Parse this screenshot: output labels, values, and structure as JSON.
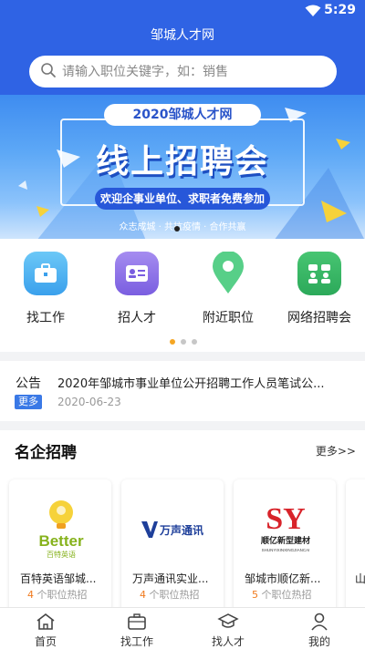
{
  "status": {
    "time": "5:29",
    "wifi_icon": "wifi-icon"
  },
  "header": {
    "title": "邹城人才网"
  },
  "search": {
    "placeholder": "请输入职位关键字，如：销售",
    "icon": "search-icon"
  },
  "banner": {
    "ribbon": "2020邹城人才网",
    "headline": "线上招聘会",
    "pill": "欢迎企事业单位、求职者免费参加",
    "tagline": "众志成城 · 共抗疫情 · 合作共赢"
  },
  "categories": [
    {
      "label": "找工作",
      "icon": "briefcase-icon",
      "color": "#4fb3f0"
    },
    {
      "label": "招人才",
      "icon": "id-card-icon",
      "color": "#8f73e8"
    },
    {
      "label": "附近职位",
      "icon": "location-pin-icon",
      "color": "#4dc781"
    },
    {
      "label": "网络招聘会",
      "icon": "group-chat-icon",
      "color": "#33b561"
    }
  ],
  "notice": {
    "tag": "公告",
    "more": "更多",
    "title": "2020年邹城市事业单位公开招聘工作人员笔试公...",
    "date": "2020-06-23"
  },
  "companies": {
    "title": "名企招聘",
    "more": "更多>>",
    "items": [
      {
        "name": "百特英语邹城...",
        "count": "4",
        "suffix": "个职位热招",
        "logo_text": "Better",
        "logo_sub": "百特英语"
      },
      {
        "name": "万声通讯实业...",
        "count": "4",
        "suffix": "个职位热招",
        "logo_text": "万声通讯"
      },
      {
        "name": "邹城市顺亿新...",
        "count": "5",
        "suffix": "个职位热招",
        "logo_text": "顺亿新型建材",
        "logo_sub": "SHUNYIXINXINGJIANCAI"
      },
      {
        "name": "山",
        "count": "",
        "suffix": ""
      }
    ]
  },
  "tabbar": [
    {
      "label": "首页",
      "icon": "home-icon"
    },
    {
      "label": "找工作",
      "icon": "briefcase-icon"
    },
    {
      "label": "找人才",
      "icon": "graduation-cap-icon"
    },
    {
      "label": "我的",
      "icon": "user-icon"
    }
  ],
  "colors": {
    "primary": "#2f63e4",
    "accent": "#f07a1d"
  }
}
